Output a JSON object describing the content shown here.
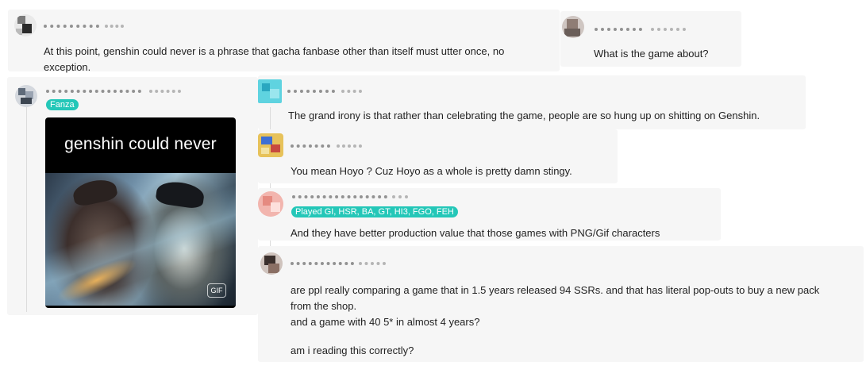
{
  "comments": [
    {
      "id": "c1",
      "text_lines": [
        "At this point, genshin could never is a phrase that gacha fanbase other than itself must utter once, no",
        "exception."
      ]
    },
    {
      "id": "c2",
      "text_lines": [
        "What is the game about?"
      ]
    },
    {
      "id": "c3",
      "badge": "Fanza",
      "media": {
        "caption": "genshin could never",
        "watermark": "GIF"
      }
    },
    {
      "id": "c4",
      "text_lines": [
        "The grand irony is that rather than celebrating the game, people are so hung up on shitting on Genshin."
      ]
    },
    {
      "id": "c5",
      "text_lines": [
        "You mean Hoyo ? Cuz Hoyo as a whole is pretty damn stingy."
      ]
    },
    {
      "id": "c6",
      "badge": "Played GI, HSR, BA, GT, HI3, FGO, FEH",
      "text_lines": [
        "And they have better production value that those games with PNG/Gif characters"
      ]
    },
    {
      "id": "c7",
      "text_lines": [
        "are ppl really comparing a game that in 1.5 years released 94 SSRs. and that has literal pop-outs to buy a new pack",
        "from the shop.",
        "and a game with 40 5* in almost 4 years?",
        "",
        "am i reading this correctly?"
      ]
    }
  ],
  "colors": {
    "badge": "#24c7b8",
    "card": "#f6f6f6",
    "text": "#222222"
  }
}
